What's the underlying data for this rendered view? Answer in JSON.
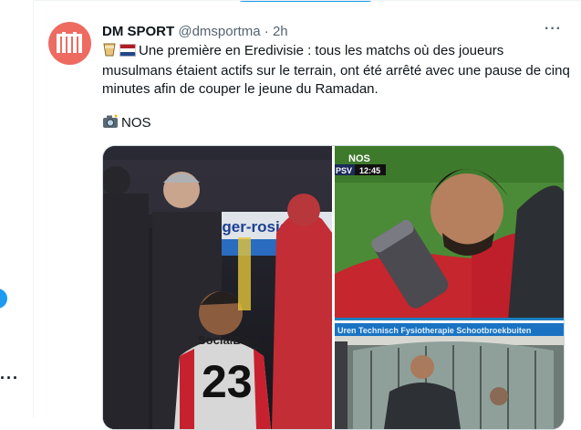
{
  "tweet": {
    "author_name": "DM SPORT",
    "handle": "@dmsportma",
    "separator": "·",
    "time": "2h",
    "text": "Une première en Eredivisie : tous les matchs où des joueurs musulmans étaient actifs sur le terrain, ont été arrêté avec une pause de cinq minutes afin de couper le jeune du Ramadan.",
    "source_label": "NOS",
    "icons": [
      "drink-emoji-icon",
      "netherlands-flag-icon",
      "camera-flash-emoji-icon",
      "more-options-icon"
    ]
  },
  "media": {
    "image1": {
      "sign_text": "nger-rosie",
      "shirt_sponsor": "SocialBlox",
      "shirt_number": "23"
    },
    "image2": {
      "broadcaster": "NOS",
      "scoreboard_team": "PSV",
      "clock": "12:45"
    },
    "image3": {
      "banner_text": "Uren Technisch Fysiotherapie Schootbroekbuiten"
    }
  },
  "colors": {
    "avatar": "#ee6b61",
    "muted_text": "#536471",
    "accent_blue": "#1d9bf0",
    "border": "#eff3f4"
  }
}
